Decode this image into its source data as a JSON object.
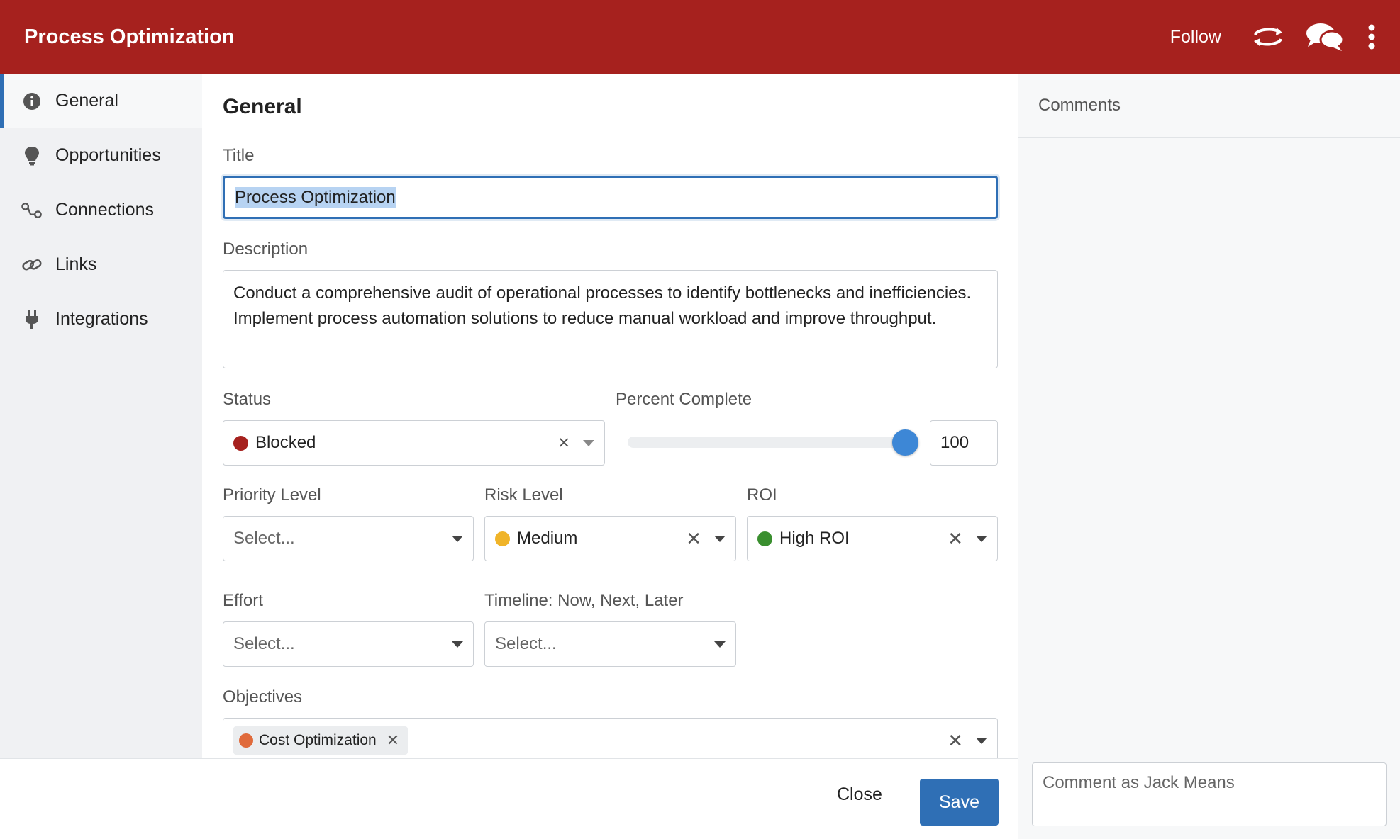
{
  "header": {
    "title": "Process Optimization",
    "follow_label": "Follow",
    "icons": [
      "sync-icon",
      "chat-bubbles-icon",
      "more-vertical-icon"
    ]
  },
  "sidebar": {
    "items": [
      {
        "label": "General",
        "icon": "info-icon",
        "active": true
      },
      {
        "label": "Opportunities",
        "icon": "lightbulb-icon"
      },
      {
        "label": "Connections",
        "icon": "connections-icon"
      },
      {
        "label": "Links",
        "icon": "link-icon"
      },
      {
        "label": "Integrations",
        "icon": "plug-icon"
      }
    ]
  },
  "main": {
    "section_title": "General",
    "title": {
      "label": "Title",
      "value": "Process Optimization"
    },
    "description": {
      "label": "Description",
      "value": "Conduct a comprehensive audit of operational processes to identify bottlenecks and inefficiencies. Implement process automation solutions to reduce manual workload and improve throughput."
    },
    "status": {
      "label": "Status",
      "value": "Blocked",
      "color": "#a6211e"
    },
    "percent_complete": {
      "label": "Percent Complete",
      "value": "100",
      "fraction": 1.0
    },
    "priority_level": {
      "label": "Priority Level",
      "placeholder": "Select..."
    },
    "risk_level": {
      "label": "Risk Level",
      "value": "Medium",
      "color": "#f0b429"
    },
    "roi": {
      "label": "ROI",
      "value": "High ROI",
      "color": "#3a8f2f"
    },
    "effort": {
      "label": "Effort",
      "placeholder": "Select..."
    },
    "timeline": {
      "label": "Timeline: Now, Next, Later",
      "placeholder": "Select..."
    },
    "objectives": {
      "label": "Objectives",
      "tags": [
        {
          "label": "Cost Optimization",
          "color": "#e06a3b"
        }
      ]
    }
  },
  "right_panel": {
    "heading": "Comments",
    "comment_placeholder": "Comment as Jack Means"
  },
  "footer": {
    "close_label": "Close",
    "save_label": "Save"
  },
  "colors": {
    "header_bg": "#a6211e",
    "accent": "#2f6fb5"
  }
}
